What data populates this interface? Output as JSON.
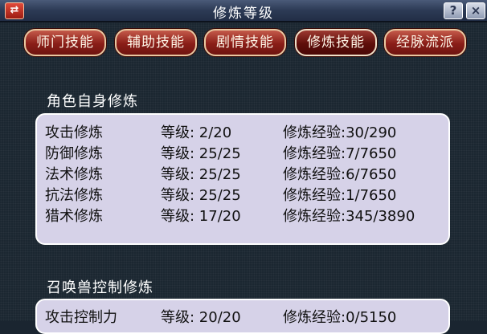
{
  "window": {
    "title": "修炼等级"
  },
  "titlebar_buttons": {
    "swap": "⇄",
    "help": "?",
    "close": "×"
  },
  "tabs": [
    {
      "label": "师门技能",
      "active": false
    },
    {
      "label": "辅助技能",
      "active": false
    },
    {
      "label": "剧情技能",
      "active": false
    },
    {
      "label": "修炼技能",
      "active": true
    },
    {
      "label": "经脉流派",
      "active": false
    }
  ],
  "character_section": {
    "title": "角色自身修炼",
    "rows": [
      {
        "name": "攻击修炼",
        "level": "等级:  2/20",
        "exp": "修炼经验:30/290"
      },
      {
        "name": "防御修炼",
        "level": "等级: 25/25",
        "exp": "修炼经验:7/7650"
      },
      {
        "name": "法术修炼",
        "level": "等级: 25/25",
        "exp": "修炼经验:6/7650"
      },
      {
        "name": "抗法修炼",
        "level": "等级: 25/25",
        "exp": "修炼经验:1/7650"
      },
      {
        "name": "猎术修炼",
        "level": "等级: 17/20",
        "exp": "修炼经验:345/3890"
      }
    ]
  },
  "pet_section": {
    "title": "召唤兽控制修炼",
    "rows": [
      {
        "name": "攻击控制力",
        "level": "等级: 20/20",
        "exp": "修炼经验:0/5150"
      }
    ]
  }
}
